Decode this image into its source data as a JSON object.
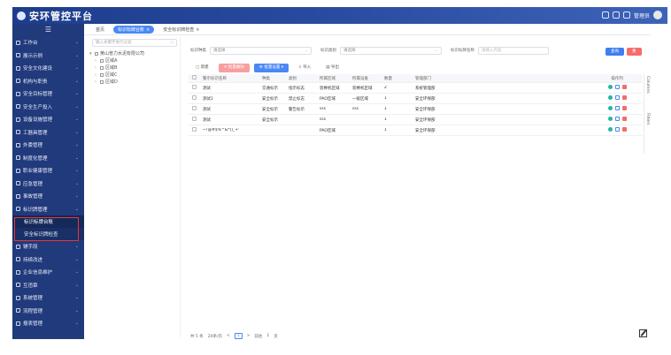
{
  "header": {
    "app_title": "安环管控平台",
    "user_label": "管理员"
  },
  "tabs": [
    {
      "label": "首页"
    },
    {
      "label": "标识标牌台账"
    },
    {
      "label": "安全标识牌检查"
    }
  ],
  "sidebar": {
    "fold_icon": "menu-fold-icon",
    "items": [
      {
        "label": "工作台"
      },
      {
        "label": "展示示例"
      },
      {
        "label": "安全文化建设"
      },
      {
        "label": "机构与职责"
      },
      {
        "label": "安全目标管理"
      },
      {
        "label": "安全生产投入"
      },
      {
        "label": "设备设施管理"
      },
      {
        "label": "工器具管理"
      },
      {
        "label": "外委管理"
      },
      {
        "label": "制度化管理"
      },
      {
        "label": "职业健康管理"
      },
      {
        "label": "应急管理"
      },
      {
        "label": "事故管理"
      },
      {
        "label": "标识牌管理"
      }
    ],
    "sub_items": [
      {
        "label": "标识标牌台账"
      },
      {
        "label": "安全标识牌检查"
      }
    ],
    "items_after": [
      {
        "label": "辅手段"
      },
      {
        "label": "持续改进"
      },
      {
        "label": "企业信息维护"
      },
      {
        "label": "互违章"
      },
      {
        "label": "系统管理"
      },
      {
        "label": "流程管理"
      },
      {
        "label": "报表管理"
      }
    ]
  },
  "tree": {
    "search_placeholder": "输入关键字进行过滤",
    "root": "黄山普力水泥有限公司",
    "children": [
      "区域A",
      "区域B",
      "区域C",
      "区域D"
    ]
  },
  "filters": {
    "name_label": "标识种类",
    "name_value": "请选择",
    "type_label": "标识类别",
    "type_value": "请选择",
    "keyword_label": "标识标牌名称",
    "keyword_placeholder": "请输入内容",
    "query_label": "查询",
    "reset_label": "重置"
  },
  "toolbar": {
    "add_label": "新建",
    "batch_delete_label": "批量删除",
    "batch_settings_label": "批量设置",
    "import_label": "导入",
    "export_label": "导出"
  },
  "side_strip": {
    "columns_label": "Columns",
    "filters_label": "Filters"
  },
  "table": {
    "headers": [
      "警示标识名称",
      "种类",
      "类别",
      "所属区域",
      "所属设备",
      "数量",
      "管理部门",
      "操作列"
    ],
    "rows": [
      [
        "测试",
        "交通标示",
        "指示标志",
        "装棒机区域",
        "装棒机区域",
        "2",
        "系统管理部"
      ],
      [
        "测试1",
        "安全标示",
        "禁止标志",
        "PAO区域",
        "一级区域",
        "1",
        "安全环保部"
      ],
      [
        "测试",
        "安全标示",
        "警告标示",
        "sss",
        "sss",
        "1",
        "安全环保部"
      ],
      [
        "测试",
        "安全标示",
        "",
        "sss",
        "",
        "1",
        "安全环保部"
      ],
      [
        "~!@#$%^&*()_+'",
        "",
        "",
        "PAO区域",
        "",
        "1",
        "安全环保部"
      ]
    ]
  },
  "pager": {
    "total": "共 5 条",
    "page_size": "20条/页",
    "prev": "<",
    "current": "1",
    "next": ">",
    "goto": "前往",
    "goto_value": "1",
    "page_suffix": "页"
  }
}
